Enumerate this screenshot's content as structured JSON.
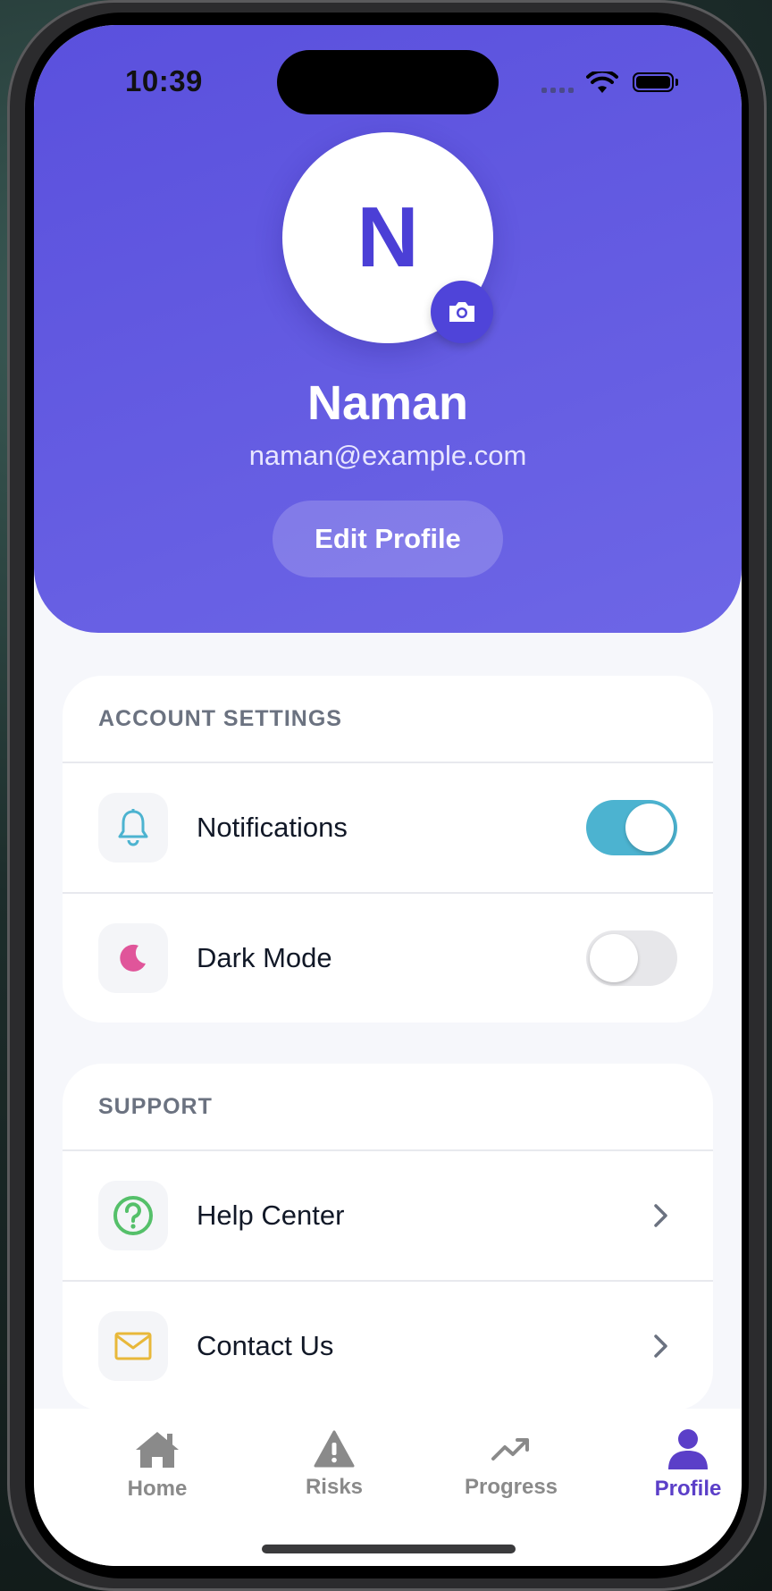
{
  "status_bar": {
    "time": "10:39"
  },
  "profile": {
    "initial": "N",
    "name": "Naman",
    "email": "naman@example.com",
    "edit_label": "Edit Profile"
  },
  "account_settings": {
    "title": "ACCOUNT SETTINGS",
    "items": [
      {
        "label": "Notifications",
        "icon": "bell-icon",
        "enabled": true
      },
      {
        "label": "Dark Mode",
        "icon": "moon-icon",
        "enabled": false
      }
    ]
  },
  "support": {
    "title": "SUPPORT",
    "items": [
      {
        "label": "Help Center",
        "icon": "help-circle-icon"
      },
      {
        "label": "Contact Us",
        "icon": "mail-icon"
      }
    ]
  },
  "tabs": [
    {
      "label": "Home",
      "icon": "home-icon",
      "active": false
    },
    {
      "label": "Risks",
      "icon": "warning-icon",
      "active": false
    },
    {
      "label": "Progress",
      "icon": "trending-up-icon",
      "active": false
    },
    {
      "label": "Profile",
      "icon": "person-icon",
      "active": true
    }
  ],
  "colors": {
    "header_start": "#5a50dd",
    "header_end": "#6d66e6",
    "accent": "#4f44d9",
    "toggle_on": "#4cb3d0",
    "active_tab": "#5b3fc8",
    "bell": "#4cb3d0",
    "moon": "#e0559a",
    "help": "#55c06a",
    "mail": "#e8b83a"
  }
}
